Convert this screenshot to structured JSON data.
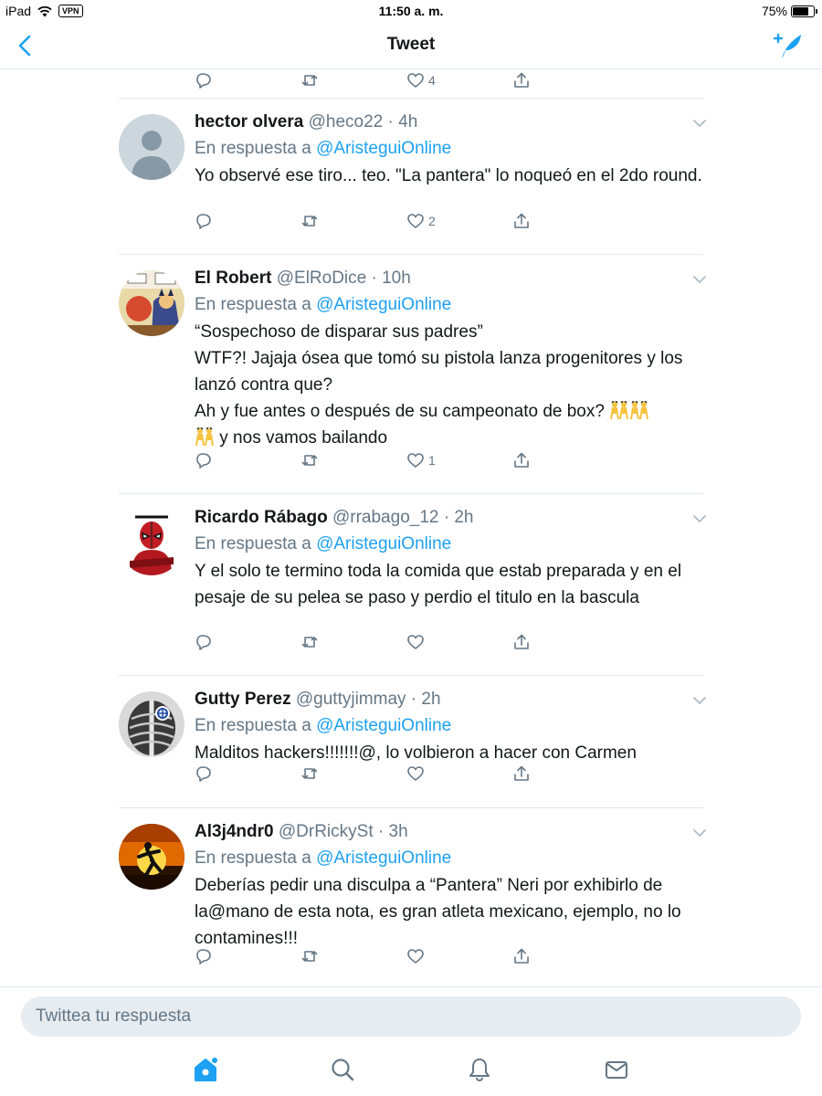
{
  "status": {
    "device": "iPad",
    "vpn": "VPN",
    "time": "11:50 a. m.",
    "battery": "75%",
    "battery_level": 0.75
  },
  "nav": {
    "title": "Tweet"
  },
  "top_actions": {
    "like_count": "4"
  },
  "in_reply_prefix": "En respuesta a",
  "replies": [
    {
      "name": "hector olvera",
      "handle": "@heco22",
      "time": "4h",
      "mention": "@AristeguiOnline",
      "lines": [
        "Yo observé ese tiro... teo. \"La pantera\" lo noqueó en el 2do round."
      ],
      "likes": "2"
    },
    {
      "name": "El Robert",
      "handle": "@ElRoDice",
      "time": "10h",
      "mention": "@AristeguiOnline",
      "lines": [
        "“Sospechoso de disparar sus padres”",
        "WTF?! Jajaja ósea que tomó su pistola lanza progenitores y los lanzó contra que?",
        "Ah y fue antes o después de su campeonato de box?"
      ],
      "tail": "y  nos vamos bailando",
      "likes": "1"
    },
    {
      "name": "Ricardo Rábago",
      "handle": "@rrabago_12",
      "time": "2h",
      "mention": "@AristeguiOnline",
      "lines": [
        "Y el solo te termino toda la comida que estab preparada y en el pesaje de su pelea se paso y perdio el titulo en la bascula"
      ],
      "likes": ""
    },
    {
      "name": "Gutty Perez",
      "handle": "@guttyjimmay",
      "time": "2h",
      "mention": "@AristeguiOnline",
      "lines": [
        "Malditos hackers!!!!!!!@, lo volbieron a hacer con Carmen"
      ],
      "likes": ""
    },
    {
      "name": "Al3j4ndr0",
      "handle": "@DrRickySt",
      "time": "3h",
      "mention": "@AristeguiOnline",
      "lines": [
        "Deberías pedir una disculpa a “Pantera” Neri por exhibirlo de la@mano de esta nota, es gran atleta mexicano, ejemplo, no lo contamines!!!"
      ],
      "likes": ""
    }
  ],
  "composer": {
    "placeholder": "Twittea tu respuesta"
  },
  "colors": {
    "accent": "#1da1f2",
    "muted": "#657786",
    "divider": "#e1e8ed"
  },
  "icons": [
    "back-chevron-icon",
    "compose-tweet-icon",
    "reply-icon",
    "retweet-icon",
    "like-icon",
    "share-icon",
    "home-icon",
    "search-icon",
    "notifications-icon",
    "messages-icon",
    "chevron-down-icon"
  ]
}
